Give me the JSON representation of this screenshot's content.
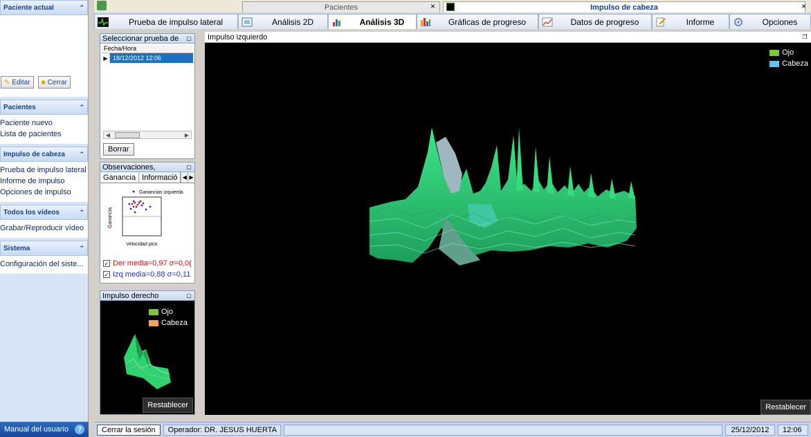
{
  "sidebar": {
    "paciente_actual": {
      "title": "Paciente actual",
      "edit_label": "Editar",
      "close_label": "Cerrar"
    },
    "pacientes": {
      "title": "Pacientes",
      "items": [
        "Paciente nuevo",
        "Lista de pacientes"
      ]
    },
    "impulso": {
      "title": "Impulso de cabeza",
      "items": [
        "Prueba de impulso lateral",
        "Informe de impulso",
        "Opciones de impulso"
      ]
    },
    "videos": {
      "title": "Todos los vídeos",
      "items": [
        "Grabar/Reproducir vídeo"
      ]
    },
    "sistema": {
      "title": "Sistema",
      "items": [
        "Configuración del siste..."
      ]
    },
    "manual": "Manual del usuario"
  },
  "topstrip": {
    "pacientes_tab": "Pacientes",
    "impulso_tab": "Impulso de cabeza",
    "close_glyph": "×"
  },
  "tabs": [
    {
      "label": "Prueba de impulso lateral",
      "icon": "pulse-icon"
    },
    {
      "label": "Análisis 2D",
      "icon": "chart-2d-icon"
    },
    {
      "label": "Análisis 3D",
      "icon": "chart-3d-icon"
    },
    {
      "label": "Gráficas de progreso",
      "icon": "bars-icon"
    },
    {
      "label": "Datos de progreso",
      "icon": "line-chart-icon"
    },
    {
      "label": "Informe",
      "icon": "report-icon"
    },
    {
      "label": "Opciones",
      "icon": "gear-icon"
    }
  ],
  "select_panel": {
    "title": "Seleccionar prueba de",
    "column": "Fecha/Hora",
    "rows": [
      "18/12/2012 12:06"
    ],
    "delete_label": "Borrar"
  },
  "obs_panel": {
    "title": "Observaciones,",
    "tabs": [
      "Ganancia",
      "Informació"
    ],
    "legend": "Ganancias izquierda",
    "ylabel": "Ganancia",
    "xlabel": "Velocidad pico",
    "der": "Der media=0,97 σ=0,0(",
    "izq": "Izq media=0,88 σ=0,11"
  },
  "right_panel": {
    "title": "Impulso derecho",
    "legend": [
      {
        "label": "Ojo",
        "color": "#7ec636"
      },
      {
        "label": "Cabeza",
        "color": "#f4a460"
      }
    ],
    "reset_label": "Restablecer"
  },
  "main_view": {
    "title": "Impulso izquierdo",
    "legend": [
      {
        "label": "Ojo",
        "color": "#7ec636"
      },
      {
        "label": "Cabeza",
        "color": "#5ec7e8"
      }
    ],
    "reset_label": "Restablecer"
  },
  "status": {
    "logout": "Cerrar la sesión",
    "operator": "Operador: DR. JESUS HUERTA",
    "date": "25/12/2012",
    "time": "12:06"
  }
}
